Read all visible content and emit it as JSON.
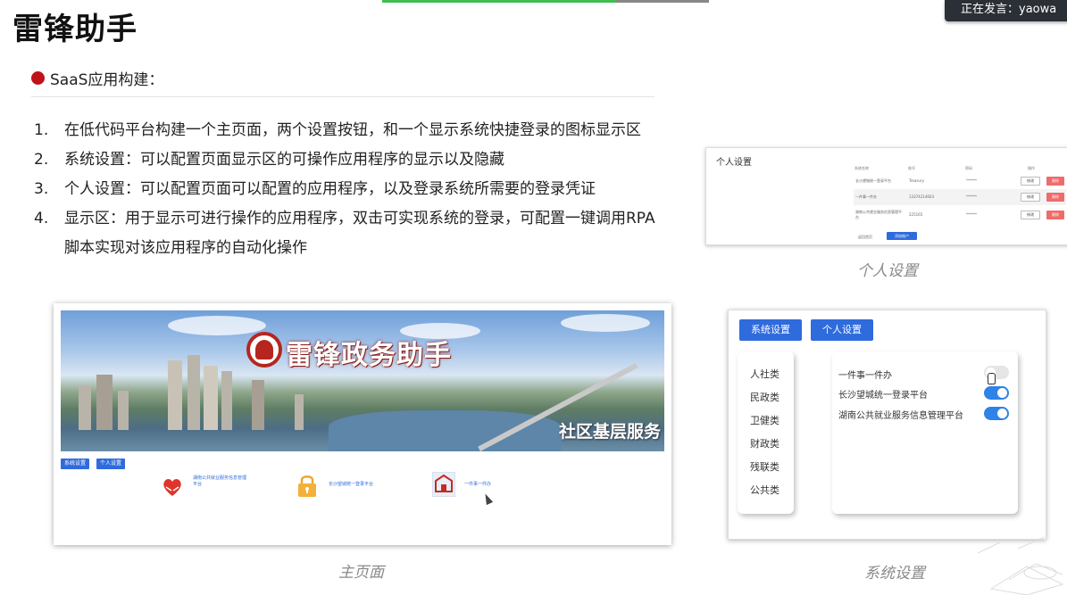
{
  "header": {
    "title": "雷锋助手",
    "speaker_status": "正在发言：yaowa"
  },
  "section": {
    "label": "SaaS应用构建："
  },
  "steps": [
    {
      "num": "1.",
      "text": "在低代码平台构建一个主页面，两个设置按钮，和一个显示系统快捷登录的图标显示区"
    },
    {
      "num": "2.",
      "text": "系统设置：可以配置页面显示区的可操作应用程序的显示以及隐藏"
    },
    {
      "num": "3.",
      "text": "个人设置：可以配置页面可以配置的应用程序，以及登录系统所需要的登录凭证"
    },
    {
      "num": "4.",
      "text": "显示区：用于显示可进行操作的应用程序，双击可实现系统的登录，可配置一键调用RPA脚本实现对该应用程序的自动化操作"
    }
  ],
  "main_page": {
    "banner_title": "雷锋政务助手",
    "banner_subtitle": "社区基层服务",
    "system_settings_button": "系统设置",
    "personal_settings_button": "个人设置",
    "apps": [
      {
        "label": "湖南公共就业服务信息管理平台",
        "icon": "heart-hands-icon"
      },
      {
        "label": "长沙望城统一登录平台",
        "icon": "lock-icon"
      },
      {
        "label": "一件事一件办",
        "icon": "building-icon"
      }
    ],
    "caption": "主页面"
  },
  "personal_settings": {
    "title": "个人设置",
    "headers": [
      "系统名称",
      "账号",
      "密码",
      "操作"
    ],
    "rows": [
      {
        "name": "长沙望城统一登录平台",
        "account": "Treasury",
        "password": "******",
        "edit": "修改",
        "delete": "删除"
      },
      {
        "name": "一件事一件办",
        "account": "13374214603",
        "password": "******",
        "edit": "修改",
        "delete": "删除"
      },
      {
        "name": "湖南公共就业服务信息管理平台",
        "account": "225165",
        "password": "******",
        "edit": "修改",
        "delete": "删除"
      }
    ],
    "back_link": "返回首页",
    "add_button": "添加账户",
    "caption": "个人设置"
  },
  "system_settings": {
    "tabs": [
      "系统设置",
      "个人设置"
    ],
    "categories": [
      "人社类",
      "民政类",
      "卫健类",
      "财政类",
      "残联类",
      "公共类"
    ],
    "items": [
      {
        "label": "一件事一件办",
        "enabled": false
      },
      {
        "label": "长沙望城统一登录平台",
        "enabled": true
      },
      {
        "label": "湖南公共就业服务信息管理平台",
        "enabled": true
      }
    ],
    "caption": "系统设置"
  },
  "colors": {
    "accent_blue": "#2f6bdc",
    "toggle_on": "#2f82e8",
    "bullet_red": "#c0121a",
    "delete_red": "#f06b6b"
  }
}
